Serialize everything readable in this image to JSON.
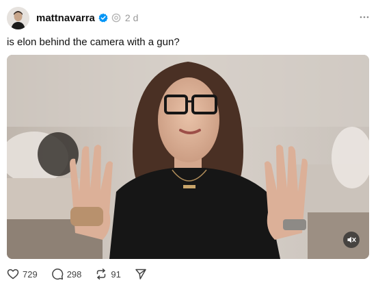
{
  "post": {
    "username": "mattnavarra",
    "timestamp": "2 d",
    "text": "is elon behind the camera with a gun?",
    "verified": true
  },
  "media": {
    "type": "video",
    "mute_icon": "muted-speaker-icon"
  },
  "actions": {
    "likes": "729",
    "replies": "298",
    "reposts": "91"
  },
  "icons": {
    "verified": "verified-badge-icon",
    "threads": "threads-logo-icon",
    "more": "more-options-icon",
    "like": "heart-icon",
    "reply": "comment-icon",
    "repost": "repost-icon",
    "share": "send-icon"
  },
  "colors": {
    "verified_blue": "#0095f6",
    "muted_text": "#999999",
    "action_text": "#424242"
  }
}
